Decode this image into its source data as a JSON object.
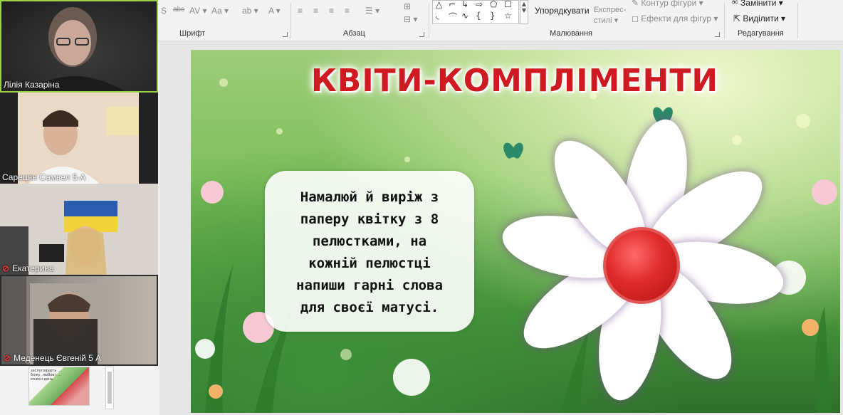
{
  "ribbon": {
    "font_group_label": "Шрифт",
    "paragraph_group_label": "Абзац",
    "drawing_group_label": "Малювання",
    "editing_group_label": "Редагування",
    "arrange_label": "Упорядкувати",
    "quick_styles_label": "Експрес-\nстилі",
    "quick_styles_line1": "Експрес-",
    "quick_styles_line2": "стилі",
    "shape_outline_label": "Контур фігури",
    "shape_effects_label": "Ефекти для фігур",
    "replace_label": "Замінити",
    "select_label": "Виділити",
    "font_tools": [
      "S",
      "abc",
      "AV",
      "Aa",
      "A"
    ]
  },
  "participants": [
    {
      "name": "Лілія Казаріна",
      "muted": false
    },
    {
      "name": "Сарецян Самвел 5-А",
      "muted": false
    },
    {
      "name": "Екатерина",
      "muted": true
    },
    {
      "name": "Меденець Євгеній 5 А",
      "muted": true
    }
  ],
  "thumbnail": {
    "text": "заслуговують ... божу, любов і ... кожен день."
  },
  "slide": {
    "title": "КВІТИ-КОМПЛІМЕНТИ",
    "body_lines": [
      "Намалюй й виріж з",
      "паперу квітку з 8",
      "пелюстками, на",
      "кожній пелюстці",
      "напиши гарні слова",
      "для своєї матусі."
    ],
    "petal_count": 8,
    "colors": {
      "title": "#d01a22",
      "flower_center": "#e02a2a",
      "petal": "#ffffff",
      "background": "#7fbf5c"
    }
  },
  "icons": {
    "mic_muted": "muted-mic-icon",
    "shapes": "shapes-gallery-icon"
  }
}
